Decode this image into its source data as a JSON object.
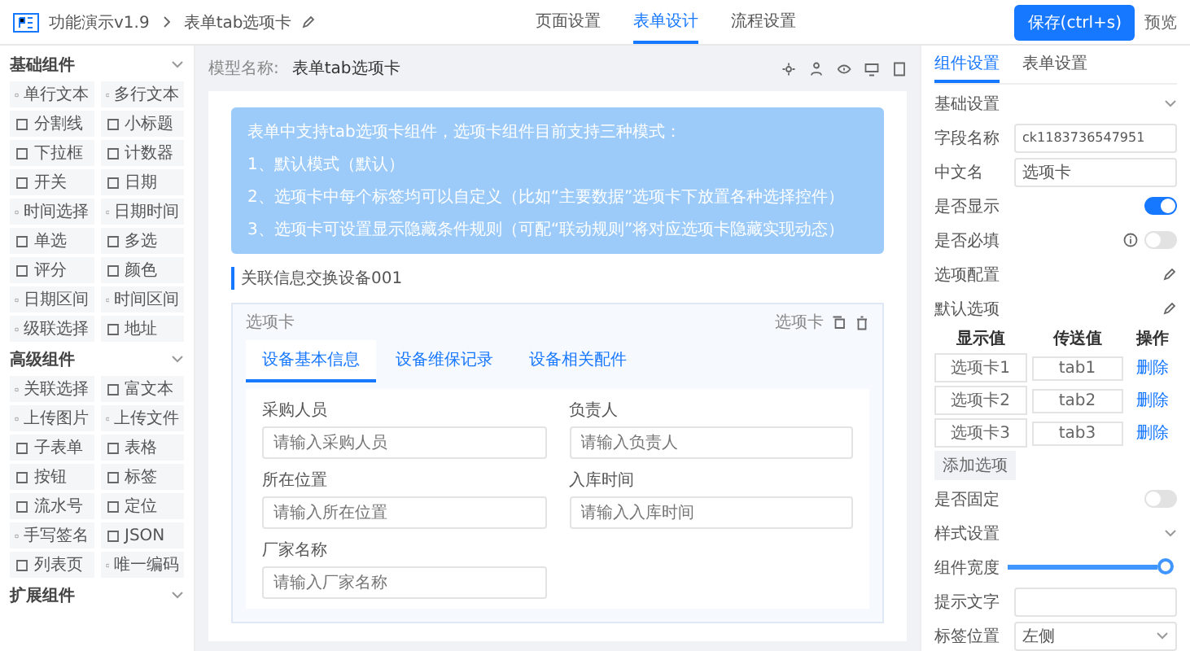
{
  "header": {
    "breadcrumb": [
      "功能演示v1.9",
      "表单tab选项卡"
    ],
    "nav_tabs": [
      {
        "label": "页面设置",
        "selected": false
      },
      {
        "label": "表单设计",
        "selected": true
      },
      {
        "label": "流程设置",
        "selected": false
      }
    ],
    "save_button": "保存(ctrl+s)",
    "preview": "预览"
  },
  "sidebar": {
    "groups": [
      {
        "title": "基础组件",
        "items": [
          "单行文本",
          "多行文本",
          "分割线",
          "小标题",
          "下拉框",
          "计数器",
          "开关",
          "日期",
          "时间选择",
          "日期时间",
          "单选",
          "多选",
          "评分",
          "颜色",
          "日期区间",
          "时间区间",
          "级联选择",
          "地址"
        ]
      },
      {
        "title": "高级组件",
        "items": [
          "关联选择",
          "富文本",
          "上传图片",
          "上传文件",
          "子表单",
          "表格",
          "按钮",
          "标签",
          "流水号",
          "定位",
          "手写签名",
          "JSON",
          "列表页",
          "唯一编码"
        ]
      },
      {
        "title": "扩展组件"
      }
    ]
  },
  "canvas": {
    "model_label": "模型名称:",
    "model_name": "表单tab选项卡",
    "notice": [
      "表单中支持tab选项卡组件，选项卡组件目前支持三种模式：",
      "1、默认模式（默认）",
      "2、选项卡中每个标签均可以自定义（比如“主要数据”选项卡下放置各种选择控件）",
      "3、选项卡可设置显示隐藏条件规则（可配“联动规则”将对应选项卡隐藏实现动态）"
    ],
    "section_title": "关联信息交换设备001",
    "card": {
      "title": "选项卡",
      "badge": "选项卡",
      "tabs": [
        {
          "label": "设备基本信息",
          "selected": true
        },
        {
          "label": "设备维保记录",
          "selected": false
        },
        {
          "label": "设备相关配件",
          "selected": false
        }
      ],
      "fields": [
        {
          "label": "采购人员",
          "placeholder": "请输入采购人员"
        },
        {
          "label": "负责人",
          "placeholder": "请输入负责人"
        },
        {
          "label": "所在位置",
          "placeholder": "请输入所在位置"
        },
        {
          "label": "入库时间",
          "placeholder": "请输入入库时间"
        },
        {
          "label": "厂家名称",
          "placeholder": "请输入厂家名称"
        }
      ]
    }
  },
  "panel": {
    "tabs": [
      {
        "label": "组件设置",
        "selected": true
      },
      {
        "label": "表单设置",
        "selected": false
      }
    ],
    "basic_title": "基础设置",
    "field_name": {
      "label": "字段名称",
      "value": "ck1183736547951"
    },
    "cn_name": {
      "label": "中文名",
      "value": "选项卡"
    },
    "visible": {
      "label": "是否显示",
      "on": true
    },
    "required": {
      "label": "是否必填",
      "on": false
    },
    "option_links": [
      "选项配置",
      "默认选项"
    ],
    "option_table": {
      "columns": [
        "显示值",
        "传送值",
        "操作"
      ],
      "rows": [
        {
          "display": "选项卡1",
          "value": "tab1",
          "action": "删除"
        },
        {
          "display": "选项卡2",
          "value": "tab2",
          "action": "删除"
        },
        {
          "display": "选项卡3",
          "value": "tab3",
          "action": "删除"
        }
      ]
    },
    "add_button": "添加选项",
    "fixed": {
      "label": "是否固定",
      "on": false
    },
    "style_title": "样式设置",
    "width": {
      "label": "组件宽度",
      "level": 1
    },
    "hint": {
      "label": "提示文字"
    },
    "label_pos": {
      "label": "标签位置",
      "value": "左侧"
    }
  }
}
